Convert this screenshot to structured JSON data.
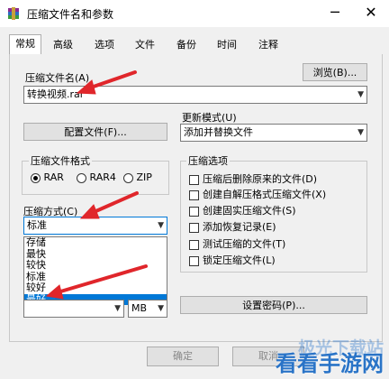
{
  "window": {
    "title": "压缩文件名和参数",
    "minimize": "─",
    "close": "✕",
    "app_icon": "winrar-icon"
  },
  "tabs": [
    {
      "label": "常规",
      "active": true
    },
    {
      "label": "高级"
    },
    {
      "label": "选项"
    },
    {
      "label": "文件"
    },
    {
      "label": "备份"
    },
    {
      "label": "时间"
    },
    {
      "label": "注释"
    }
  ],
  "archive_name": {
    "label": "压缩文件名(A)",
    "value": "转换视频.rar",
    "browse": "浏览(B)..."
  },
  "profiles_button": "配置文件(F)...",
  "update_mode": {
    "label": "更新模式(U)",
    "value": "添加并替换文件"
  },
  "format": {
    "label": "压缩文件格式",
    "options": [
      {
        "label": "RAR",
        "checked": true
      },
      {
        "label": "RAR4",
        "checked": false
      },
      {
        "label": "ZIP",
        "checked": false
      }
    ]
  },
  "method": {
    "label": "压缩方式(C)",
    "value": "标准",
    "list": [
      {
        "label": "存储"
      },
      {
        "label": "最快"
      },
      {
        "label": "较快"
      },
      {
        "label": "标准"
      },
      {
        "label": "较好"
      },
      {
        "label": "最好",
        "selected": true
      }
    ]
  },
  "volume_unit": "MB",
  "options": {
    "label": "压缩选项",
    "items": [
      {
        "label": "压缩后删除原来的文件(D)",
        "checked": false
      },
      {
        "label": "创建自解压格式压缩文件(X)",
        "checked": false
      },
      {
        "label": "创建固实压缩文件(S)",
        "checked": false
      },
      {
        "label": "添加恢复记录(E)",
        "checked": false
      },
      {
        "label": "测试压缩的文件(T)",
        "checked": false
      },
      {
        "label": "锁定压缩文件(L)",
        "checked": false
      }
    ]
  },
  "password_button": "设置密码(P)...",
  "ok_button": "确定",
  "cancel_button": "取消",
  "watermark": {
    "line1": "极光下载站",
    "line2": "看看手游网"
  },
  "colors": {
    "arrow": "#e0262b",
    "selection": "#0078d7"
  }
}
